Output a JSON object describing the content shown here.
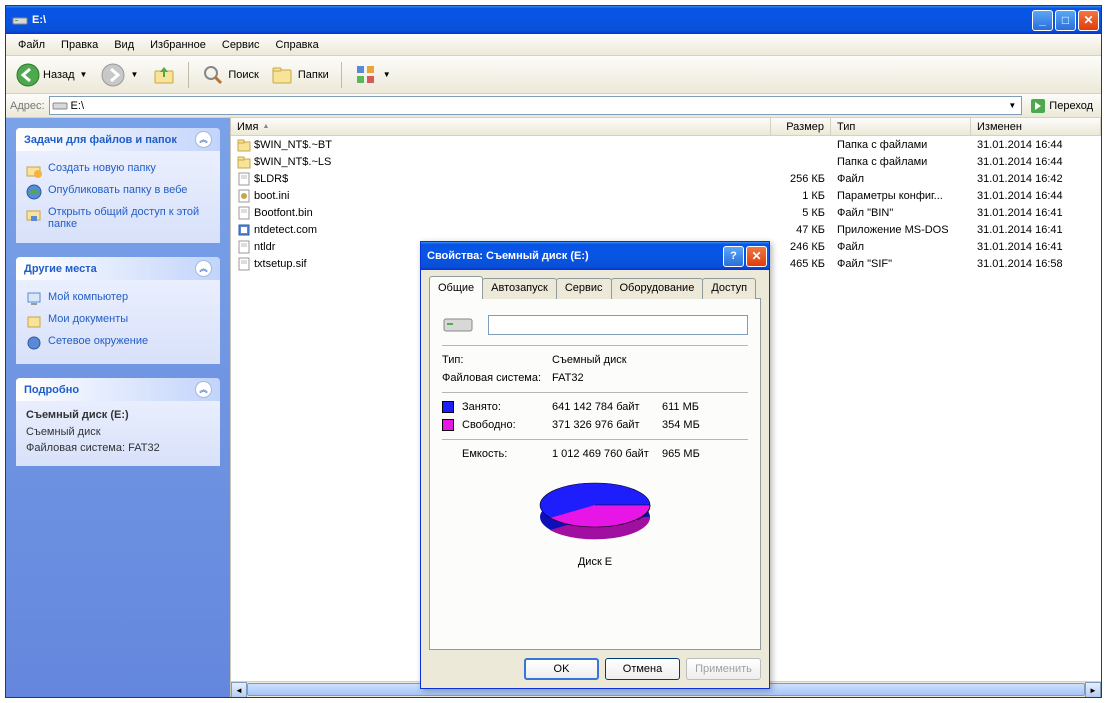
{
  "window": {
    "title": "E:\\"
  },
  "menubar": [
    "Файл",
    "Правка",
    "Вид",
    "Избранное",
    "Сервис",
    "Справка"
  ],
  "toolbar": {
    "back": "Назад",
    "search": "Поиск",
    "folders": "Папки"
  },
  "addressbar": {
    "label": "Адрес:",
    "value": "E:\\",
    "go": "Переход"
  },
  "sidebar": {
    "tasks": {
      "title": "Задачи для файлов и папок",
      "items": [
        "Создать новую папку",
        "Опубликовать папку в вебе",
        "Открыть общий доступ к этой папке"
      ]
    },
    "places": {
      "title": "Другие места",
      "items": [
        "Мой компьютер",
        "Мои документы",
        "Сетевое окружение"
      ]
    },
    "details": {
      "title": "Подробно",
      "name": "Съемный диск (E:)",
      "type": "Съемный диск",
      "fs": "Файловая система: FAT32"
    }
  },
  "file_header": {
    "name": "Имя",
    "size": "Размер",
    "type": "Тип",
    "modified": "Изменен"
  },
  "files": [
    {
      "name": "$WIN_NT$.~BT",
      "size": "",
      "type": "Папка с файлами",
      "date": "31.01.2014 16:44",
      "icon": "folder"
    },
    {
      "name": "$WIN_NT$.~LS",
      "size": "",
      "type": "Папка с файлами",
      "date": "31.01.2014 16:44",
      "icon": "folder"
    },
    {
      "name": "$LDR$",
      "size": "256 КБ",
      "type": "Файл",
      "date": "31.01.2014 16:42",
      "icon": "file"
    },
    {
      "name": "boot.ini",
      "size": "1 КБ",
      "type": "Параметры конфиг...",
      "date": "31.01.2014 16:44",
      "icon": "ini"
    },
    {
      "name": "Bootfont.bin",
      "size": "5 КБ",
      "type": "Файл \"BIN\"",
      "date": "31.01.2014 16:41",
      "icon": "file"
    },
    {
      "name": "ntdetect.com",
      "size": "47 КБ",
      "type": "Приложение MS-DOS",
      "date": "31.01.2014 16:41",
      "icon": "app"
    },
    {
      "name": "ntldr",
      "size": "246 КБ",
      "type": "Файл",
      "date": "31.01.2014 16:41",
      "icon": "file"
    },
    {
      "name": "txtsetup.sif",
      "size": "465 КБ",
      "type": "Файл \"SIF\"",
      "date": "31.01.2014 16:58",
      "icon": "file"
    }
  ],
  "dialog": {
    "title": "Свойства: Съемный диск (E:)",
    "tabs": [
      "Общие",
      "Автозапуск",
      "Сервис",
      "Оборудование",
      "Доступ"
    ],
    "type_lbl": "Тип:",
    "type_val": "Съемный диск",
    "fs_lbl": "Файловая система:",
    "fs_val": "FAT32",
    "used_lbl": "Занято:",
    "used_bytes": "641 142 784 байт",
    "used_mb": "611 МБ",
    "free_lbl": "Свободно:",
    "free_bytes": "371 326 976 байт",
    "free_mb": "354 МБ",
    "cap_lbl": "Емкость:",
    "cap_bytes": "1 012 469 760 байт",
    "cap_mb": "965 МБ",
    "disk_lbl": "Диск E",
    "ok": "OK",
    "cancel": "Отмена",
    "apply": "Применить"
  },
  "colors": {
    "used": "#1e1efc",
    "free": "#e716e7"
  },
  "chart_data": {
    "type": "pie",
    "title": "Диск E",
    "series": [
      {
        "name": "Занято",
        "value": 641142784,
        "color": "#1e1efc"
      },
      {
        "name": "Свободно",
        "value": 371326976,
        "color": "#e716e7"
      }
    ],
    "total": 1012469760
  }
}
